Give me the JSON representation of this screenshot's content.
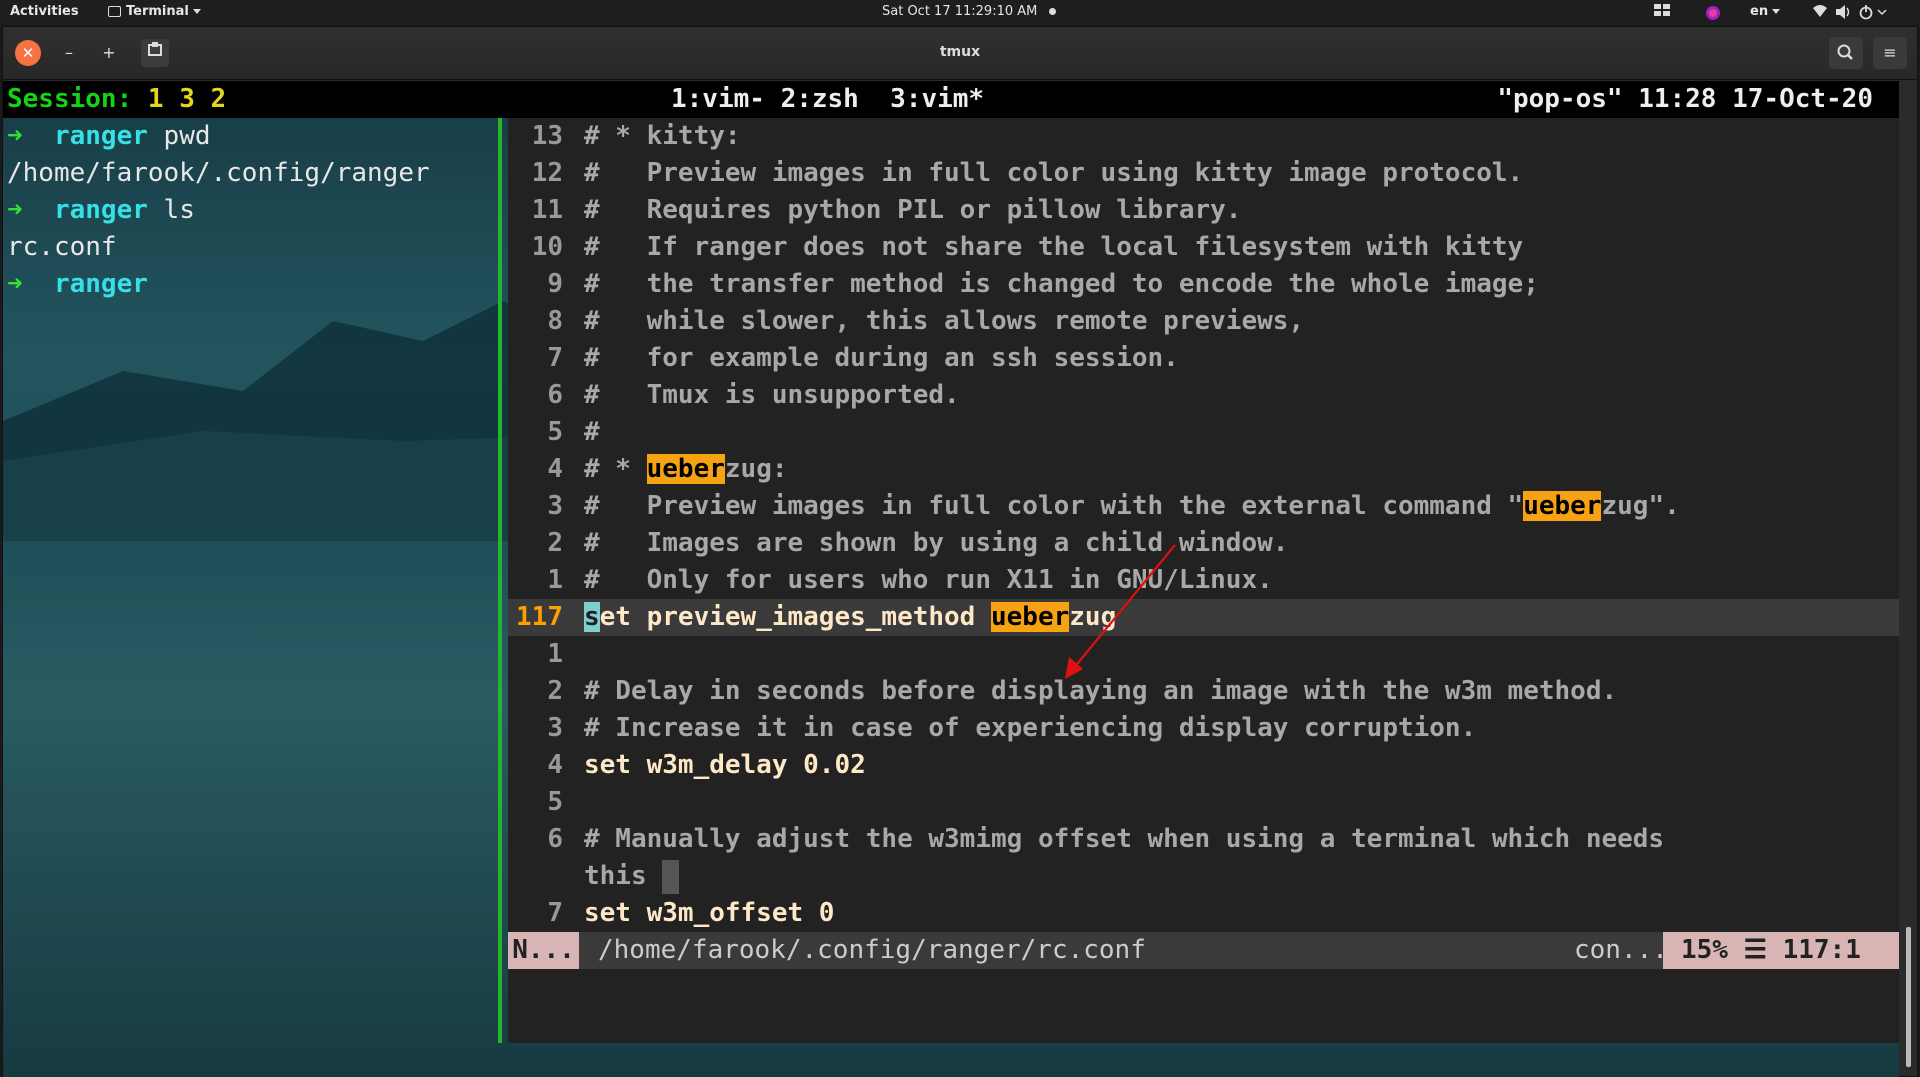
{
  "topbar": {
    "activities": "Activities",
    "app_menu": "Terminal",
    "clock": "Sat Oct 17  11:29:10 AM",
    "language": "en"
  },
  "window": {
    "title": "tmux",
    "close_glyph": "✕",
    "minimize_glyph": "–",
    "add_glyph": "+",
    "menu_glyph": "≡"
  },
  "tmux": {
    "session_label": "Session:",
    "session_ids": "1 3 2",
    "windows": "1:vim- 2:zsh  3:vim*",
    "host_info": "\"pop-os\" 11:28 17-Oct-20"
  },
  "left_pane": {
    "prompt_arrow": "➜",
    "lines": [
      {
        "type": "cmd",
        "dir": "ranger",
        "cmd": " pwd"
      },
      {
        "type": "out",
        "text": "/home/farook/.config/ranger"
      },
      {
        "type": "cmd",
        "dir": "ranger",
        "cmd": " ls"
      },
      {
        "type": "out",
        "text": "rc.conf"
      },
      {
        "type": "cmd",
        "dir": "ranger",
        "cmd": ""
      }
    ]
  },
  "vim": {
    "lines": [
      {
        "num": "13",
        "pre": "# * kitty:"
      },
      {
        "num": "12",
        "pre": "#   Preview images in full color using kitty image protocol."
      },
      {
        "num": "11",
        "pre": "#   Requires python PIL or pillow library."
      },
      {
        "num": "10",
        "pre": "#   If ranger does not share the local filesystem with kitty"
      },
      {
        "num": "9",
        "pre": "#   the transfer method is changed to encode the whole image;"
      },
      {
        "num": "8",
        "pre": "#   while slower, this allows remote previews,"
      },
      {
        "num": "7",
        "pre": "#   for example during an ssh session."
      },
      {
        "num": "6",
        "pre": "#   Tmux is unsupported."
      },
      {
        "num": "5",
        "pre": "#"
      },
      {
        "num": "4",
        "pre": "# * ",
        "hl": "ueber",
        "post": "zug:"
      },
      {
        "num": "3",
        "pre": "#   Preview images in full color with the external command \"",
        "hl": "ueber",
        "post": "zug\"."
      },
      {
        "num": "2",
        "pre": "#   Images are shown by using a child window."
      },
      {
        "num": "1",
        "pre": "#   Only for users who run X11 in GNU/Linux."
      },
      {
        "num": "117",
        "current": true,
        "cursor": "s",
        "pre": "et preview_images_method ",
        "hl": "ueber",
        "post": "zug"
      },
      {
        "num": "1",
        "pre": ""
      },
      {
        "num": "2",
        "pre": "# Delay in seconds before displaying an image with the w3m method."
      },
      {
        "num": "3",
        "pre": "# Increase it in case of experiencing display corruption."
      },
      {
        "num": "4",
        "pre": "set w3m_delay 0.02",
        "stmt": true
      },
      {
        "num": "5",
        "pre": ""
      },
      {
        "num": "6",
        "pre": "# Manually adjust the w3mimg offset when using a terminal which needs"
      },
      {
        "num": "",
        "pre": "this ",
        "wrap": true
      },
      {
        "num": "7",
        "pre": "set w3m_offset 0",
        "stmt": true
      }
    ],
    "status": {
      "mode": "N...",
      "path": "/home/farook/.config/ranger/rc.conf",
      "filetype": "con...",
      "position": "15% ☰ 117:1"
    }
  },
  "colors": {
    "tmux_session": "#14d414",
    "pane_border": "#29b329",
    "search_highlight": "#f7a213",
    "line_number_current": "#ff9f00",
    "annotation_arrow": "#e01010"
  }
}
